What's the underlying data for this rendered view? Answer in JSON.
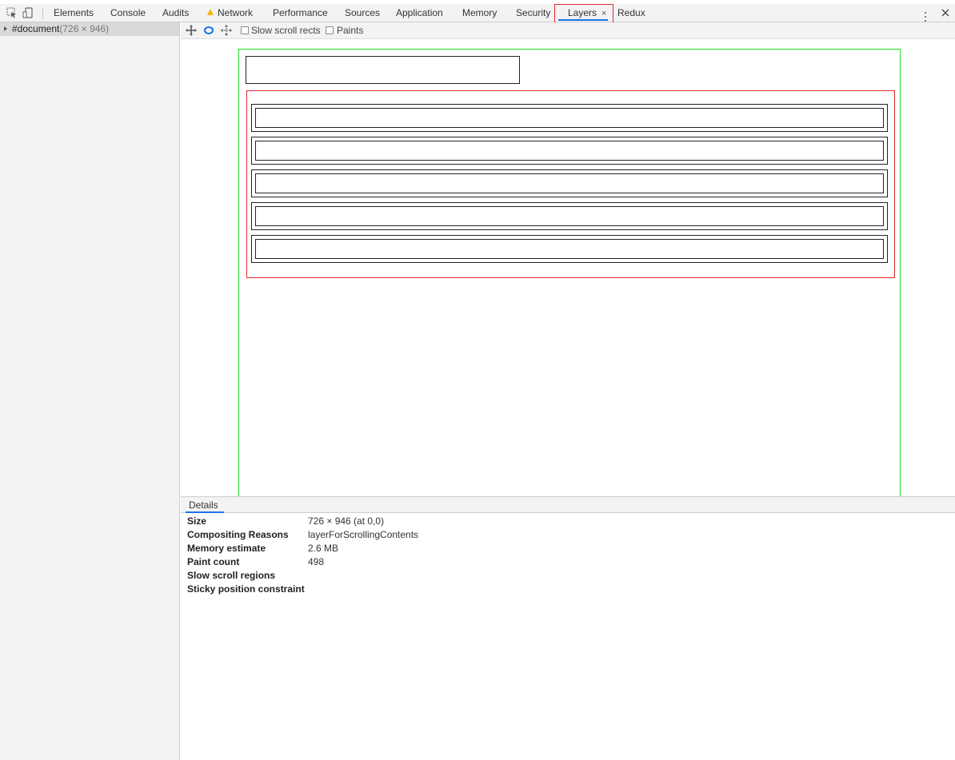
{
  "tabs": [
    {
      "label": "Elements"
    },
    {
      "label": "Console"
    },
    {
      "label": "Audits"
    },
    {
      "label": "Network",
      "warning": true
    },
    {
      "label": "Performance"
    },
    {
      "label": "Sources"
    },
    {
      "label": "Application"
    },
    {
      "label": "Memory"
    },
    {
      "label": "Security"
    },
    {
      "label": "Layers",
      "active": true,
      "closable": true,
      "close_glyph": "×"
    },
    {
      "label": "Redux"
    }
  ],
  "toolbar_icons": [
    "inspect-element-icon",
    "device-toolbar-icon",
    "more-vert-icon",
    "close-icon"
  ],
  "tree": {
    "node_label": "#document",
    "node_dims": "(726 × 946)"
  },
  "layers_toolbar": {
    "icons": [
      "pan-mode-icon",
      "rotate-mode-icon",
      "reset-transform-icon"
    ],
    "slow_scroll_rects": {
      "label": "Slow scroll rects",
      "checked": false
    },
    "paints": {
      "label": "Paints",
      "checked": false
    }
  },
  "details": {
    "tab_label": "Details",
    "rows": [
      {
        "key": "Size",
        "value": "726 × 946 (at 0,0)"
      },
      {
        "key": "Compositing Reasons",
        "value": "layerForScrollingContents"
      },
      {
        "key": "Memory estimate",
        "value": "2.6 MB"
      },
      {
        "key": "Paint count",
        "value": "498"
      },
      {
        "key": "Slow scroll regions",
        "value": ""
      },
      {
        "key": "Sticky position constraint",
        "value": ""
      }
    ]
  },
  "colors": {
    "accent": "#1a73e8",
    "highlight_box": "#e0282e",
    "layer_green": "#22dd22",
    "layer_red": "#e0282e",
    "warning": "#f4b400"
  }
}
